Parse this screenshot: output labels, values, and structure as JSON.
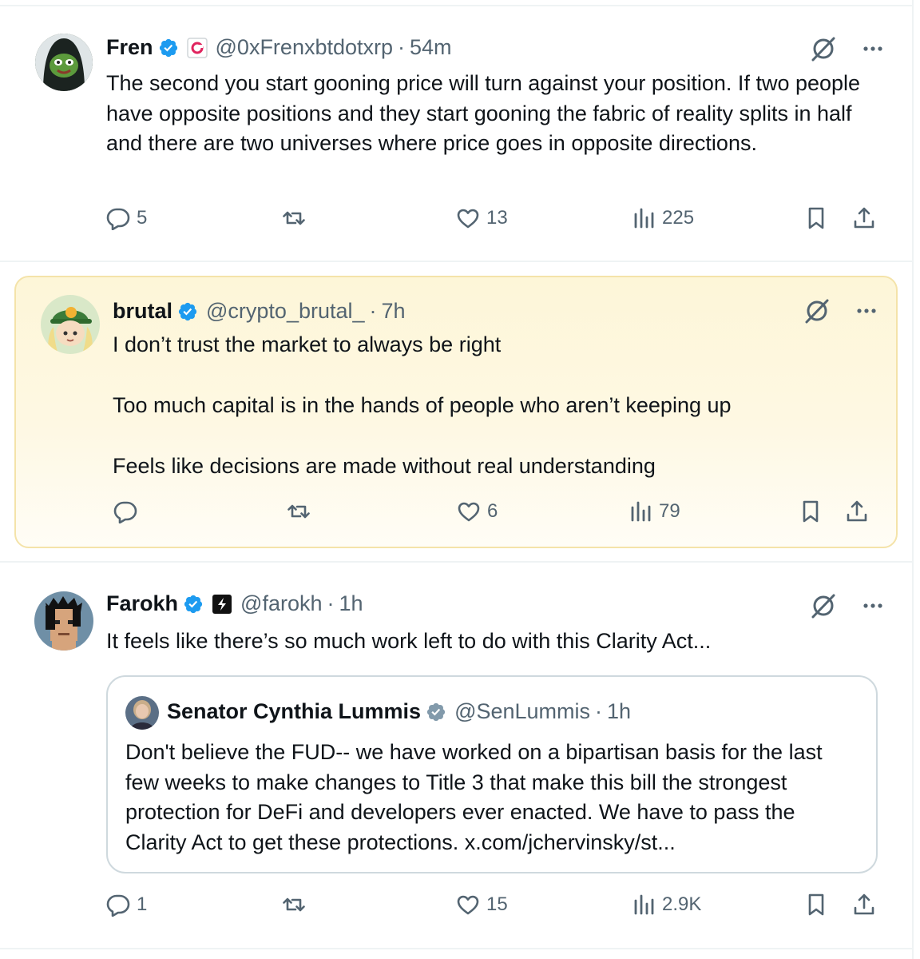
{
  "tweets": [
    {
      "name": "Fren",
      "handle": "@0xFrenxbtdotxrp",
      "time": "54m",
      "text": "The second you start gooning price will turn against your position. If two people have opposite positions and they start gooning the fabric of reality splits in half and there are two universes where price goes in opposite directions.",
      "replies": "5",
      "reposts": "",
      "likes": "13",
      "views": "225"
    },
    {
      "name": "brutal",
      "handle": "@crypto_brutal_",
      "time": "7h",
      "text": "I don’t trust the market to always be right\n\nToo much capital is in the hands of people who aren’t keeping up\n\nFeels like decisions are made without real understanding",
      "replies": "",
      "reposts": "",
      "likes": "6",
      "views": "79"
    },
    {
      "name": "Farokh",
      "handle": "@farokh",
      "time": "1h",
      "text": "It feels like there’s so much work left to do with this Clarity Act...",
      "replies": "1",
      "reposts": "",
      "likes": "15",
      "views": "2.9K",
      "quote": {
        "name": "Senator Cynthia Lummis",
        "handle": "@SenLummis",
        "time": "1h",
        "text": "Don't believe the FUD-- we have worked on a bipartisan basis for the last few weeks to make changes to Title 3 that make this bill the strongest protection for DeFi and developers ever enacted. We have to pass the Clarity Act to get these protections. x.com/jchervinsky/st..."
      }
    }
  ],
  "separator": "·",
  "colors": {
    "verified": "#1d9bf0",
    "gov_badge": "#829aab",
    "muted": "#536471",
    "text": "#0f1419",
    "highlight_bg": "#fdf6d8",
    "highlight_border": "#f4e3a9"
  },
  "icons": [
    "grok-icon",
    "more-icon",
    "reply-icon",
    "repost-icon",
    "like-icon",
    "views-icon",
    "bookmark-icon",
    "share-icon",
    "verified-badge-icon"
  ]
}
